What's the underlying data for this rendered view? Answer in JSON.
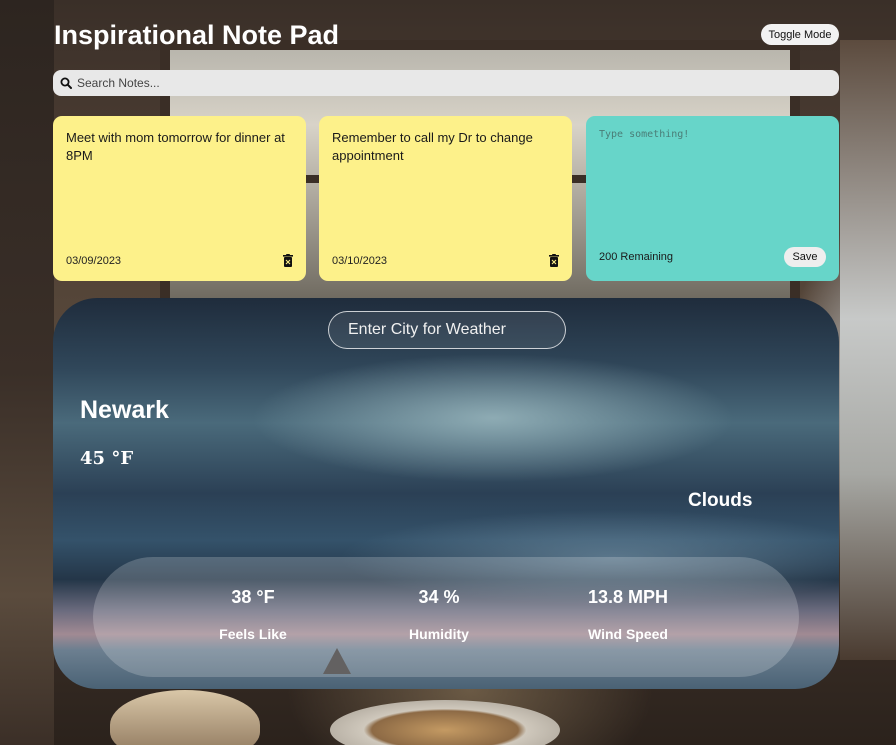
{
  "header": {
    "title": "Inspirational Note Pad",
    "toggle_label": "Toggle Mode"
  },
  "search": {
    "placeholder": "Search Notes..."
  },
  "notes": [
    {
      "text": "Meet with mom tomorrow for dinner at 8PM",
      "date": "03/09/2023"
    },
    {
      "text": "Remember to call my Dr to change appointment",
      "date": "03/10/2023"
    }
  ],
  "new_note": {
    "placeholder": "Type something!",
    "remaining": "200 Remaining",
    "save_label": "Save"
  },
  "weather": {
    "city_input_placeholder": "Enter City for Weather",
    "city": "Newark",
    "temperature": "45 °F",
    "condition": "Clouds",
    "stats": [
      {
        "value": "38 °F",
        "label": "Feels Like"
      },
      {
        "value": "34 %",
        "label": "Humidity"
      },
      {
        "value": "13.8 MPH",
        "label": "Wind Speed"
      }
    ]
  },
  "colors": {
    "note_yellow": "#fdf18a",
    "note_teal": "#67d5c9"
  },
  "icons": {
    "search": "search-icon",
    "delete": "trash-icon"
  }
}
